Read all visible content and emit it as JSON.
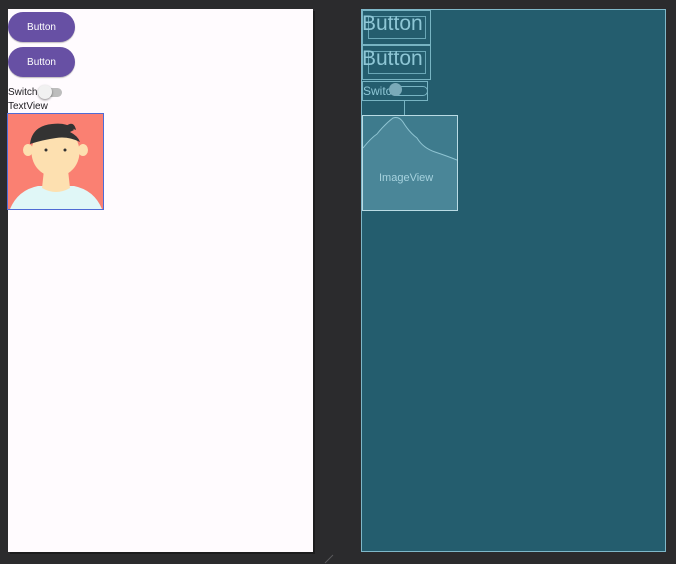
{
  "design": {
    "buttons": [
      {
        "label": "Button"
      },
      {
        "label": "Button"
      }
    ],
    "switch": {
      "label": "Switch",
      "checked": false
    },
    "textview": {
      "text": "TextView"
    },
    "image": {
      "icon": "person-avatar-icon"
    }
  },
  "blueprint": {
    "buttons": [
      {
        "label": "Button"
      },
      {
        "label": "Button"
      }
    ],
    "switch": {
      "label": "Switch"
    },
    "image": {
      "label": "ImageView",
      "icon": "image-placeholder-icon"
    }
  },
  "colors": {
    "workspace_bg": "#2b2b2d",
    "design_bg": "#fffbfe",
    "button_bg": "#6750a4",
    "button_text": "#ffffff",
    "blueprint_bg": "#245d6e",
    "blueprint_line": "#78b4c3",
    "avatar_bg": "#fa8072",
    "avatar_skin": "#fde0b0",
    "avatar_hair": "#333333",
    "avatar_shirt": "#e0f7f7"
  }
}
